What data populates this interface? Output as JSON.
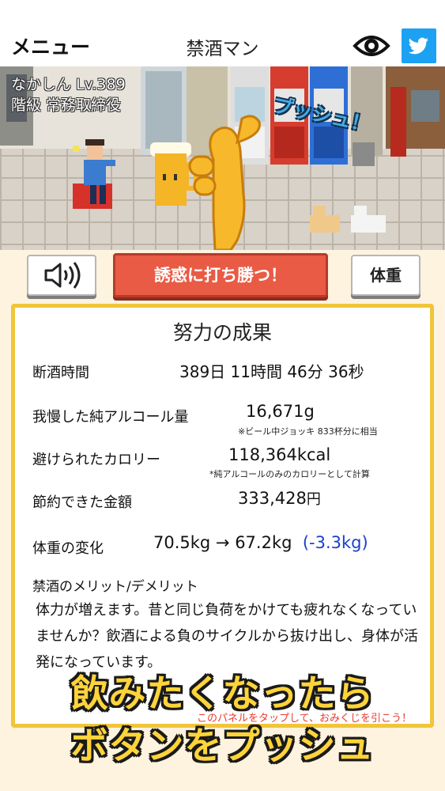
{
  "header": {
    "menu_label": "メニュー",
    "title": "禁酒マン"
  },
  "scene": {
    "player_name": "なかしん Lv.389",
    "player_rank": "階級 常務取締役",
    "push_label": "プッシュ！"
  },
  "controls": {
    "temptation_button": "誘惑に打ち勝つ！",
    "weight_button": "体重"
  },
  "results": {
    "title": "努力の成果",
    "abstinence": {
      "label": "断酒時間",
      "value": "389日 11時間 46分 36秒"
    },
    "alcohol": {
      "label": "我慢した純アルコール量",
      "value": "16,671g",
      "note": "※ビール中ジョッキ 833杯分に相当"
    },
    "calories": {
      "label": "避けられたカロリー",
      "value": "118,364kcal",
      "note": "*純アルコールのみのカロリーとして計算"
    },
    "money": {
      "label": "節約できた金額",
      "value": "333,428",
      "unit": "円"
    },
    "weight": {
      "label": "体重の変化",
      "value": "70.5kg → 67.2kg",
      "diff": "(-3.3kg)"
    },
    "merit_title": "禁酒のメリット/デメリット",
    "merit_text": "体力が増えます。昔と同じ負荷をかけても疲れなくなっていませんか？飲酒による負のサイクルから抜け出し、身体が活発になっています。",
    "tap_hint": "このパネルをタップして、おみくじを引こう！"
  },
  "caption": {
    "line1": "飲みたくなったら",
    "line2": "ボタンをプッシュ"
  },
  "colors": {
    "accent_red": "#e95b45",
    "panel_border": "#f0c53a",
    "twitter_blue": "#1da1f2",
    "caption_yellow": "#ffd43a"
  }
}
